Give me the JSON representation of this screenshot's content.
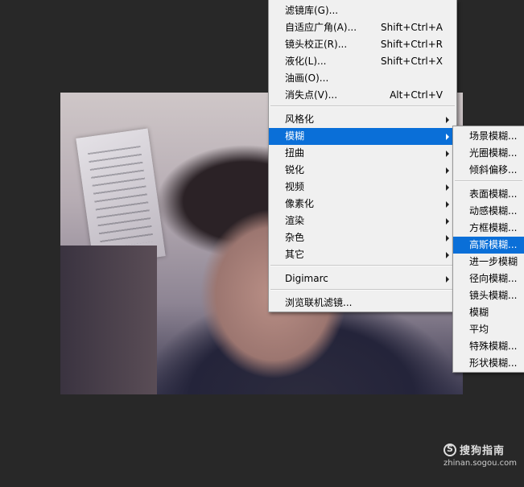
{
  "main_menu": {
    "items": [
      {
        "label": "滤镜库(G)...",
        "shortcut": ""
      },
      {
        "label": "自适应广角(A)...",
        "shortcut": "Shift+Ctrl+A"
      },
      {
        "label": "镜头校正(R)...",
        "shortcut": "Shift+Ctrl+R"
      },
      {
        "label": "液化(L)...",
        "shortcut": "Shift+Ctrl+X"
      },
      {
        "label": "油画(O)...",
        "shortcut": ""
      },
      {
        "label": "消失点(V)...",
        "shortcut": "Alt+Ctrl+V"
      },
      {
        "label": "风格化"
      },
      {
        "label": "模糊"
      },
      {
        "label": "扭曲"
      },
      {
        "label": "锐化"
      },
      {
        "label": "视频"
      },
      {
        "label": "像素化"
      },
      {
        "label": "渲染"
      },
      {
        "label": "杂色"
      },
      {
        "label": "其它"
      },
      {
        "label": "Digimarc"
      },
      {
        "label": "浏览联机滤镜..."
      }
    ]
  },
  "blur_submenu": {
    "items": [
      {
        "label": "场景模糊..."
      },
      {
        "label": "光圈模糊..."
      },
      {
        "label": "倾斜偏移..."
      },
      {
        "label": "表面模糊..."
      },
      {
        "label": "动感模糊..."
      },
      {
        "label": "方框模糊..."
      },
      {
        "label": "高斯模糊..."
      },
      {
        "label": "进一步模糊"
      },
      {
        "label": "径向模糊..."
      },
      {
        "label": "镜头模糊..."
      },
      {
        "label": "模糊"
      },
      {
        "label": "平均"
      },
      {
        "label": "特殊模糊..."
      },
      {
        "label": "形状模糊..."
      }
    ]
  },
  "active_menu_item": "模糊",
  "active_submenu_item": "高斯模糊...",
  "colors": {
    "highlight": "#0a6fd8",
    "menu_bg": "#f0f0f0",
    "app_bg": "#282828"
  },
  "watermark": {
    "title": "搜狗指南",
    "url": "zhinan.sogou.com",
    "icon": "sogou-logo-icon"
  }
}
